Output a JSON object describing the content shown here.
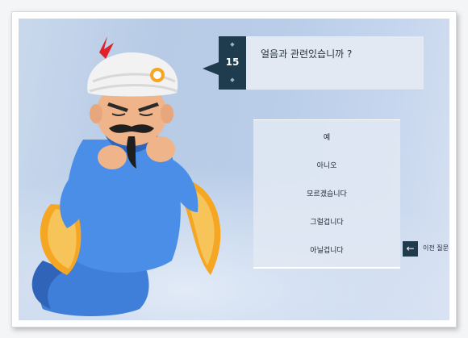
{
  "question": {
    "number": "15",
    "text": "얼음과 관련있습니까 ?"
  },
  "answers": [
    {
      "label": "예"
    },
    {
      "label": "아니오"
    },
    {
      "label": "모르겠습니다"
    },
    {
      "label": "그럴겁니다"
    },
    {
      "label": "아닐겁니다"
    }
  ],
  "navigation": {
    "back_label": "이전 질문",
    "back_icon": "arrow-left-icon"
  },
  "colors": {
    "badge": "#1f3c4f",
    "question_bg": "#e3e9f2",
    "genie_skin": "#4a8ee8",
    "turban": "#f2f2f2",
    "sleeve_gold": "#f5a623"
  }
}
